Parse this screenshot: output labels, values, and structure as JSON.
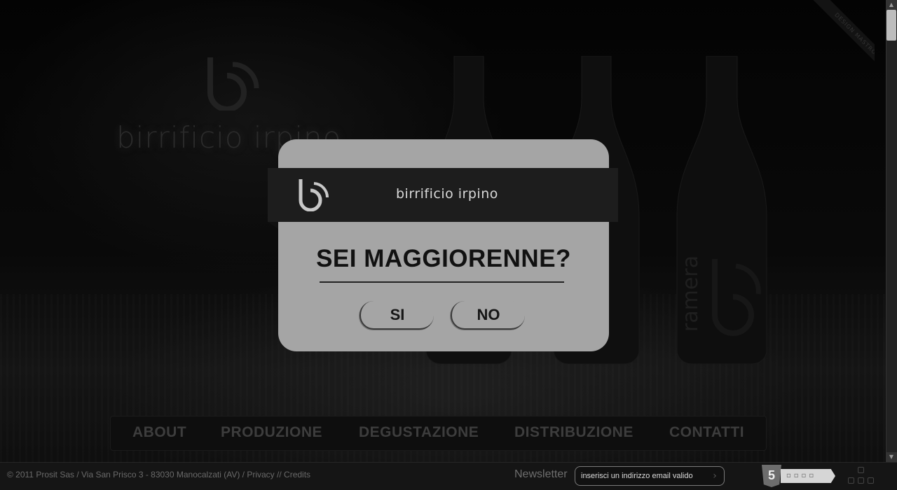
{
  "background": {
    "brand_text": "birrificio irpino",
    "bottle_label": "ramera",
    "ribbon_text": "DESIGN MASTROX"
  },
  "modal": {
    "brand": "birrificio irpino",
    "question": "SEI MAGGIORENNE?",
    "yes_label": "SI",
    "no_label": "NO"
  },
  "nav": {
    "items": [
      {
        "label": "ABOUT"
      },
      {
        "label": "PRODUZIONE"
      },
      {
        "label": "DEGUSTAZIONE"
      },
      {
        "label": "DISTRIBUZIONE"
      },
      {
        "label": "CONTATTI"
      }
    ]
  },
  "footer": {
    "copyright": "© 2011 Prosit Sas / Via San Prisco 3 - 83030 Manocalzati (AV) / ",
    "privacy": "Privacy",
    "separator": " // ",
    "credits": "Credits",
    "newsletter_label": "Newsletter",
    "newsletter_placeholder": "inserisci un indirizzo email valido",
    "html5_badge": "5",
    "go_icon": "chevron-right-icon"
  },
  "colors": {
    "modal_bg": "#a5a5a5",
    "modal_band": "#1d1d1d",
    "page_bg": "#0b0b0b"
  }
}
